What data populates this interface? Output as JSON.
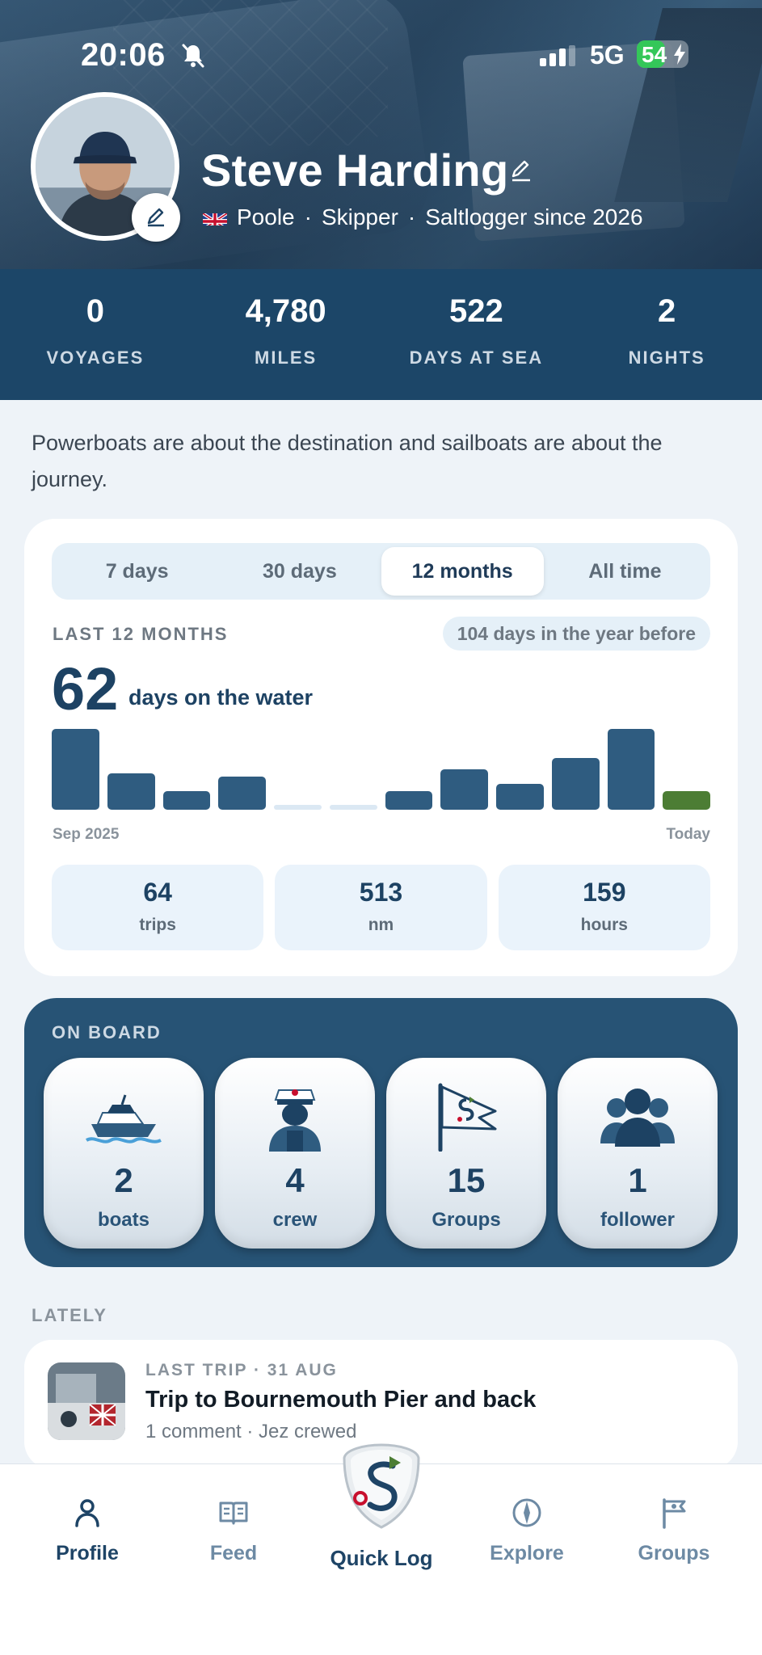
{
  "status_bar": {
    "time": "20:06",
    "network": "5G",
    "battery": "54",
    "battery_percent": 54
  },
  "profile": {
    "name": "Steve Harding",
    "location": "Poole",
    "role": "Skipper",
    "since": "Saltlogger since 2026",
    "sep": "·"
  },
  "stats": [
    {
      "value": "0",
      "label": "VOYAGES"
    },
    {
      "value": "4,780",
      "label": "MILES"
    },
    {
      "value": "522",
      "label": "DAYS AT SEA"
    },
    {
      "value": "2",
      "label": "NIGHTS"
    }
  ],
  "quote": "Powerboats are about the destination and sailboats are about the journey.",
  "activity": {
    "tabs": [
      {
        "label": "7 days",
        "active": false
      },
      {
        "label": "30 days",
        "active": false
      },
      {
        "label": "12 months",
        "active": true
      },
      {
        "label": "All time",
        "active": false
      }
    ],
    "period_label": "LAST 12 MONTHS",
    "previous": "104 days in the year before",
    "days": "62",
    "days_caption": "days on the water",
    "axis_start": "Sep 2025",
    "axis_end": "Today",
    "mini_stats": [
      {
        "value": "64",
        "label": "trips"
      },
      {
        "value": "513",
        "label": "nm"
      },
      {
        "value": "159",
        "label": "hours"
      }
    ]
  },
  "chart_data": {
    "type": "bar",
    "series": [
      {
        "values": [
          11,
          5,
          2.5,
          4.5,
          0.5,
          0.5,
          2.5,
          5.5,
          3.5,
          7,
          11,
          2.5
        ]
      }
    ],
    "highlight_last": true,
    "colors": {
      "bar": "#2f5c80",
      "empty": "#dbe8f3",
      "current": "#4c7d34"
    }
  },
  "onboard": {
    "title": "ON BOARD",
    "tiles": [
      {
        "value": "2",
        "label": "boats",
        "icon": "boat-icon"
      },
      {
        "value": "4",
        "label": "crew",
        "icon": "sailor-icon"
      },
      {
        "value": "15",
        "label": "Groups",
        "icon": "pennant-flag-icon"
      },
      {
        "value": "1",
        "label": "follower",
        "icon": "people-icon"
      }
    ]
  },
  "lately": {
    "title": "LATELY",
    "trip": {
      "meta": "LAST TRIP · 31 AUG",
      "title": "Trip to Bournemouth Pier and back",
      "sub": "1 comment · Jez crewed"
    }
  },
  "tabbar": {
    "items": [
      {
        "label": "Profile",
        "icon": "person-icon",
        "active": true
      },
      {
        "label": "Feed",
        "icon": "book-icon",
        "active": false
      },
      {
        "label": "Quick Log",
        "icon": "saltlogger-logo",
        "active": false
      },
      {
        "label": "Explore",
        "icon": "compass-icon",
        "active": false
      },
      {
        "label": "Groups",
        "icon": "flag-icon",
        "active": false
      }
    ]
  },
  "colors": {
    "primary": "#1c4668",
    "accent_green": "#4c7d34",
    "background": "#eef3f8"
  }
}
